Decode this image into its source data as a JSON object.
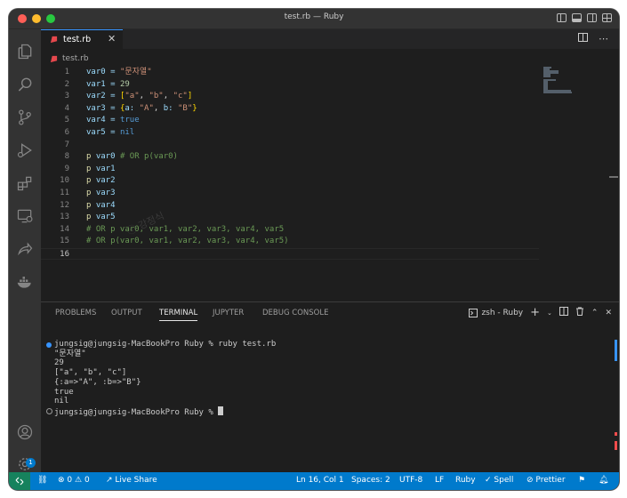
{
  "window": {
    "title": "test.rb — Ruby"
  },
  "tabs": [
    {
      "label": "test.rb",
      "close_glyph": "✕"
    }
  ],
  "breadcrumb": {
    "file": "test.rb"
  },
  "code_lines": [
    {
      "n": "1",
      "tokens": [
        [
          "var0 = ",
          "#9cdcfe"
        ],
        [
          "\"문자열\"",
          "#ce9178"
        ]
      ]
    },
    {
      "n": "2",
      "tokens": [
        [
          "var1 = ",
          "#9cdcfe"
        ],
        [
          "29",
          "#b5cea8"
        ]
      ]
    },
    {
      "n": "3",
      "tokens": [
        [
          "var2 = ",
          "#9cdcfe"
        ],
        [
          "[",
          "#ffd700"
        ],
        [
          "\"a\"",
          "#ce9178"
        ],
        [
          ", ",
          "#d4d4d4"
        ],
        [
          "\"b\"",
          "#ce9178"
        ],
        [
          ", ",
          "#d4d4d4"
        ],
        [
          "\"c\"",
          "#ce9178"
        ],
        [
          "]",
          "#ffd700"
        ]
      ]
    },
    {
      "n": "4",
      "tokens": [
        [
          "var3 = ",
          "#9cdcfe"
        ],
        [
          "{",
          "#ffd700"
        ],
        [
          "a: ",
          "#9cdcfe"
        ],
        [
          "\"A\"",
          "#ce9178"
        ],
        [
          ", ",
          "#d4d4d4"
        ],
        [
          "b: ",
          "#9cdcfe"
        ],
        [
          "\"B\"",
          "#ce9178"
        ],
        [
          "}",
          "#ffd700"
        ]
      ]
    },
    {
      "n": "5",
      "tokens": [
        [
          "var4 = ",
          "#9cdcfe"
        ],
        [
          "true",
          "#569cd6"
        ]
      ]
    },
    {
      "n": "6",
      "tokens": [
        [
          "var5 = ",
          "#9cdcfe"
        ],
        [
          "nil",
          "#569cd6"
        ]
      ]
    },
    {
      "n": "7",
      "tokens": []
    },
    {
      "n": "8",
      "tokens": [
        [
          "p ",
          "#dcdcaa"
        ],
        [
          "var0 ",
          "#9cdcfe"
        ],
        [
          "# OR p(var0)",
          "#6a9955"
        ]
      ]
    },
    {
      "n": "9",
      "tokens": [
        [
          "p ",
          "#dcdcaa"
        ],
        [
          "var1",
          "#9cdcfe"
        ]
      ]
    },
    {
      "n": "10",
      "tokens": [
        [
          "p ",
          "#dcdcaa"
        ],
        [
          "var2",
          "#9cdcfe"
        ]
      ]
    },
    {
      "n": "11",
      "tokens": [
        [
          "p ",
          "#dcdcaa"
        ],
        [
          "var3",
          "#9cdcfe"
        ]
      ]
    },
    {
      "n": "12",
      "tokens": [
        [
          "p ",
          "#dcdcaa"
        ],
        [
          "var4",
          "#9cdcfe"
        ]
      ]
    },
    {
      "n": "13",
      "tokens": [
        [
          "p ",
          "#dcdcaa"
        ],
        [
          "var5",
          "#9cdcfe"
        ]
      ]
    },
    {
      "n": "14",
      "tokens": [
        [
          "# OR p var0, var1, var2, var3, var4, var5",
          "#6a9955"
        ]
      ]
    },
    {
      "n": "15",
      "tokens": [
        [
          "# OR p(var0, var1, var2, var3, var4, var5)",
          "#6a9955"
        ]
      ]
    },
    {
      "n": "16",
      "tokens": []
    }
  ],
  "panel": {
    "tabs": [
      "PROBLEMS",
      "OUTPUT",
      "TERMINAL",
      "JUPYTER",
      "DEBUG CONSOLE"
    ],
    "active_tab": "TERMINAL",
    "shell": "zsh - Ruby",
    "terminal_lines": [
      "jungsig@jungsig-MacBookPro Ruby % ruby test.rb",
      "\"문자열\"",
      "29",
      "[\"a\", \"b\", \"c\"]",
      "{:a=>\"A\", :b=>\"B\"}",
      "true",
      "nil",
      "jungsig@jungsig-MacBookPro Ruby % "
    ]
  },
  "activity": {
    "badge": "1"
  },
  "status": {
    "errors": "0",
    "warnings": "0",
    "live_share": "Live Share",
    "position": "Ln 16, Col 1",
    "spaces": "Spaces: 2",
    "encoding": "UTF-8",
    "eol": "LF",
    "language": "Ruby",
    "spell": "Spell",
    "prettier": "Prettier"
  },
  "colors": {
    "accent": "#007acc",
    "remote": "#16825d",
    "editor_bg": "#1e1e1e"
  }
}
